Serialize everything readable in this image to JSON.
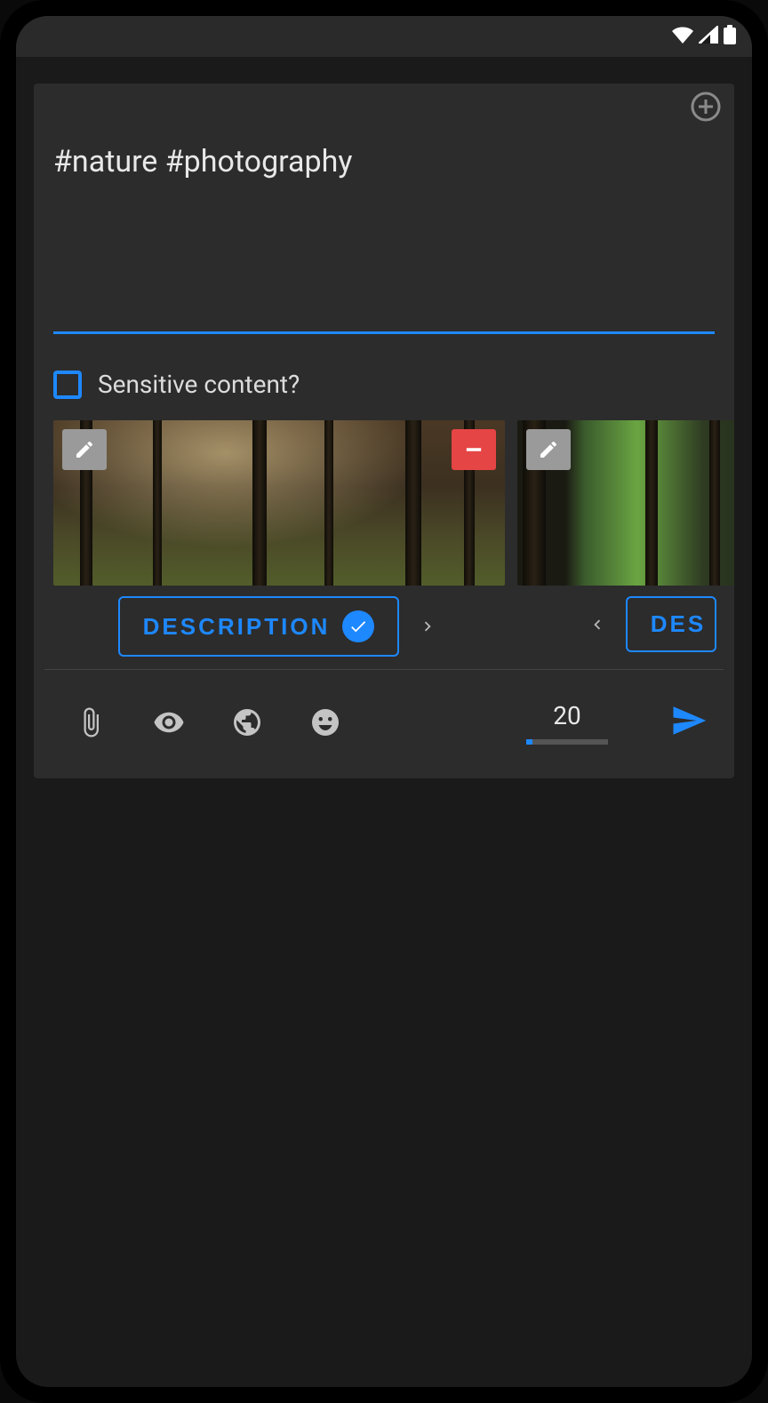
{
  "compose": {
    "text": "#nature #photography",
    "sensitive_label": "Sensitive content?",
    "sensitive_checked": false
  },
  "media": [
    {
      "description_label": "DESCRIPTION",
      "has_description": true
    },
    {
      "description_label": "DES",
      "has_description": false
    }
  ],
  "toolbar": {
    "char_count": "20"
  },
  "colors": {
    "accent": "#1e88ff",
    "danger": "#e64545",
    "card": "#2c2c2c"
  }
}
